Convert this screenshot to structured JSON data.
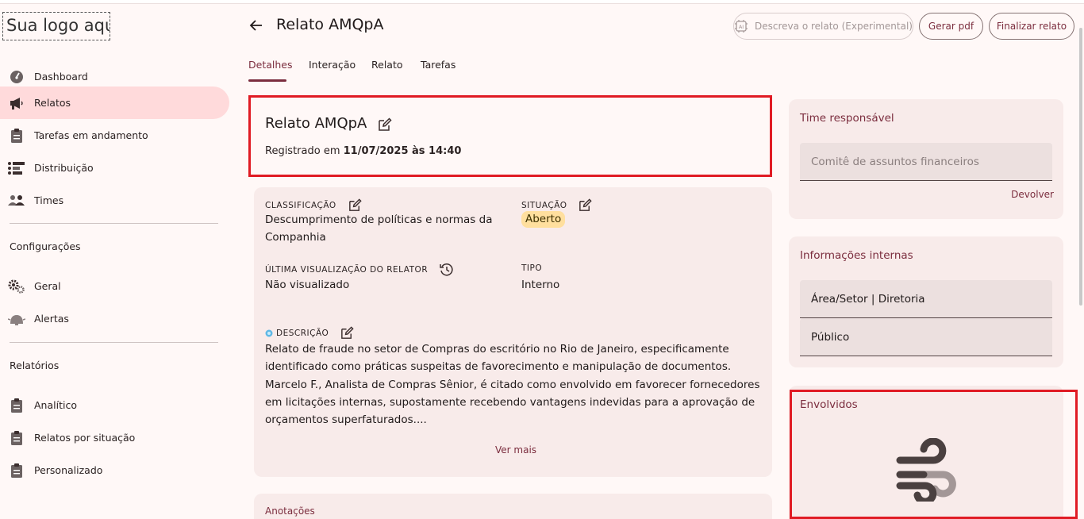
{
  "logo": "Sua logo aqui",
  "sidebar": {
    "items": [
      {
        "label": "Dashboard",
        "icon": "dashboard-icon"
      },
      {
        "label": "Relatos",
        "icon": "megaphone-icon",
        "active": true
      },
      {
        "label": "Tarefas em andamento",
        "icon": "clipboard-icon"
      },
      {
        "label": "Distribuição",
        "icon": "distribution-icon"
      },
      {
        "label": "Times",
        "icon": "group-icon"
      }
    ],
    "config_label": "Configurações",
    "config_items": [
      {
        "label": "Geral",
        "icon": "gears-icon"
      },
      {
        "label": "Alertas",
        "icon": "alert-icon"
      }
    ],
    "reports_label": "Relatórios",
    "report_items": [
      {
        "label": "Analítico",
        "icon": "clipboard-icon"
      },
      {
        "label": "Relatos por situação",
        "icon": "clipboard-icon"
      },
      {
        "label": "Personalizado",
        "icon": "clipboard-icon"
      }
    ]
  },
  "header": {
    "title": "Relato AMQpA",
    "describe_button": "Descreva o relato (Experimental)",
    "pdf_button": "Gerar pdf",
    "finish_button": "Finalizar relato"
  },
  "tabs": [
    "Detalhes",
    "Interação",
    "Relato",
    "Tarefas"
  ],
  "report": {
    "title": "Relato AMQpA",
    "registered_prefix": "Registrado em ",
    "registered_date": "11/07/2025 às 14:40",
    "classification_label": "CLASSIFICAÇÃO",
    "classification_value": "Descumprimento de políticas e normas da Companhia",
    "situation_label": "SITUAÇÃO",
    "situation_value": "Aberto",
    "last_view_label": "ÚLTIMA VISUALIZAÇÃO DO RELATOR",
    "last_view_value": "Não visualizado",
    "type_label": "TIPO",
    "type_value": "Interno",
    "description_label": "DESCRIÇÃO",
    "description": "Relato de fraude no setor de Compras do escritório no Rio de Janeiro, especificamente identificado como práticas suspeitas de favorecimento e manipulação de documentos. Marcelo F., Analista de Compras Sênior, é citado como envolvido em favorecer fornecedores em licitações internas, supostamente recebendo vantagens indevidas para a aprovação de orçamentos superfaturados....",
    "see_more": "Ver mais",
    "notes_label": "Anotações"
  },
  "right": {
    "team_title": "Time responsável",
    "team_value": "Comitê de assuntos financeiros",
    "return_button": "Devolver",
    "internal_title": "Informações internas",
    "area": "Área/Setor | Diretoria",
    "public": "Público",
    "involved_title": "Envolvidos"
  },
  "colors": {
    "accent": "#7b2d3e",
    "active_nav": "#ffdadb",
    "badge": "#ffdf9e",
    "highlight": "#e01b24"
  }
}
